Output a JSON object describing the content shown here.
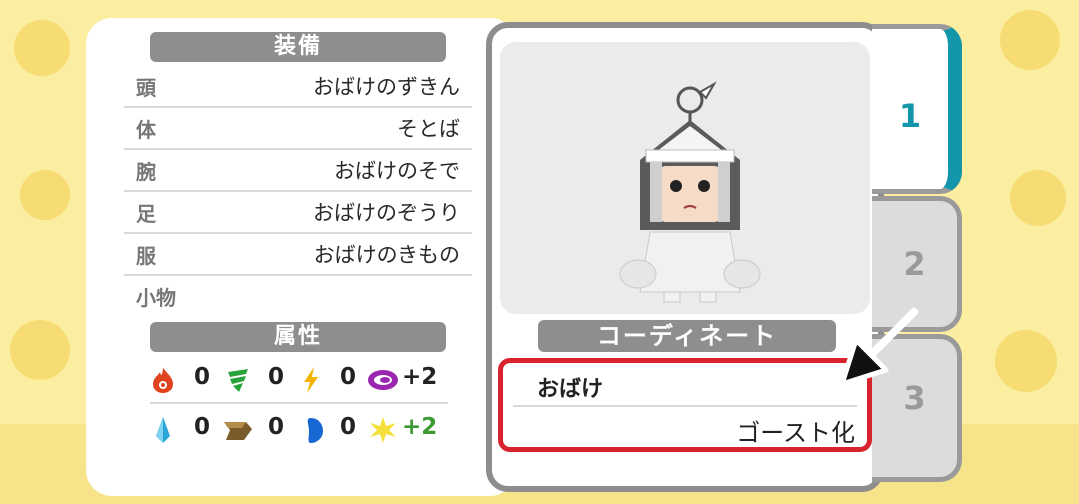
{
  "equipment": {
    "header": "装備",
    "slots": [
      {
        "slot": "頭",
        "item": "おばけのずきん"
      },
      {
        "slot": "体",
        "item": "そとば"
      },
      {
        "slot": "腕",
        "item": "おばけのそで"
      },
      {
        "slot": "足",
        "item": "おばけのぞうり"
      },
      {
        "slot": "服",
        "item": "おばけのきもの"
      },
      {
        "slot": "小物",
        "item": ""
      }
    ]
  },
  "attributes": {
    "header": "属性",
    "row1": [
      {
        "icon": "fire-icon",
        "value": "0"
      },
      {
        "icon": "wind-icon",
        "value": "0"
      },
      {
        "icon": "lightning-icon",
        "value": "0"
      },
      {
        "icon": "dark-swirl-icon",
        "value": "+2"
      }
    ],
    "row2": [
      {
        "icon": "ice-icon",
        "value": "0"
      },
      {
        "icon": "earth-icon",
        "value": "0"
      },
      {
        "icon": "water-icon",
        "value": "0"
      },
      {
        "icon": "light-icon",
        "value": "+2"
      }
    ]
  },
  "coordinate": {
    "header": "コーディネート",
    "name": "おばけ",
    "effect": "ゴースト化"
  },
  "tabs": [
    "1",
    "2",
    "3"
  ],
  "colors": {
    "accent": "#1396a9",
    "highlight": "#d8232f",
    "header": "#8e8e8e"
  }
}
